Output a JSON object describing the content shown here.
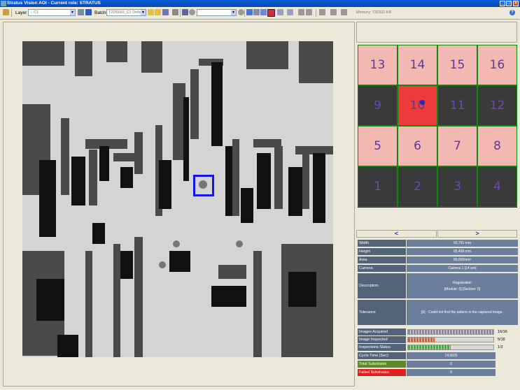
{
  "window": {
    "title": "Stratus Vision AOI - Current role: STRATUS"
  },
  "toolbar": {
    "layer_label": "Layer",
    "layer_value": "-- C1",
    "batch_label": "Batch",
    "batch_value": "T2D6669_C1 Default",
    "memory_text": "Memory: 732332 KB"
  },
  "grid": {
    "tiles": [
      {
        "label": "13",
        "style": "pink"
      },
      {
        "label": "14",
        "style": "pink"
      },
      {
        "label": "15",
        "style": "pink"
      },
      {
        "label": "16",
        "style": "pink"
      },
      {
        "label": "9",
        "style": "dark"
      },
      {
        "label": "10",
        "style": "sel"
      },
      {
        "label": "11",
        "style": "dark"
      },
      {
        "label": "12",
        "style": "dark"
      },
      {
        "label": "5",
        "style": "pink"
      },
      {
        "label": "6",
        "style": "pink"
      },
      {
        "label": "7",
        "style": "pink"
      },
      {
        "label": "8",
        "style": "pink"
      },
      {
        "label": "1",
        "style": "dark"
      },
      {
        "label": "2",
        "style": "dark"
      },
      {
        "label": "3",
        "style": "dark"
      },
      {
        "label": "4",
        "style": "dark"
      }
    ]
  },
  "nav": {
    "prev": "<",
    "next": ">"
  },
  "properties": [
    {
      "label": "Width",
      "value": "03,791 mm"
    },
    {
      "label": "Height",
      "value": "05,499 mm"
    },
    {
      "label": "Area",
      "value": "00,000mm²"
    },
    {
      "label": "Camera",
      "value": "Camera 1 [14 um]"
    },
    {
      "label": "Description",
      "value": "Registration",
      "value2": "[Module: 0] [Section: 0]"
    },
    {
      "label": "Tolerance",
      "value": "[0] - Could not find the pattern in the captured image."
    }
  ],
  "stats": {
    "images_acquired": {
      "label": "Images Acquired",
      "count": "16/16",
      "progress": 1.0,
      "color": "#8a8aa0"
    },
    "image_inspected": {
      "label": "Image Inspected",
      "count": "5/16",
      "progress": 0.3125,
      "color": "#f05a1a"
    },
    "inspections_status": {
      "label": "Inspections Status",
      "count": "1/2",
      "progress": 0.5,
      "color": "#22c022"
    },
    "cycle_time": {
      "label": "Cycle Time (Sec)",
      "value": "14,5625"
    },
    "total_substrates": {
      "label": "Total Substrates",
      "value": "0",
      "color": "#5a8a2a"
    },
    "failed_substrates": {
      "label": "Failed Substrates",
      "value": "0",
      "color": "#e02020"
    }
  },
  "colors": {
    "roi": "#1414ee",
    "titlebar": "#0a5ed8",
    "selected_tile": "#ee3a3a"
  }
}
